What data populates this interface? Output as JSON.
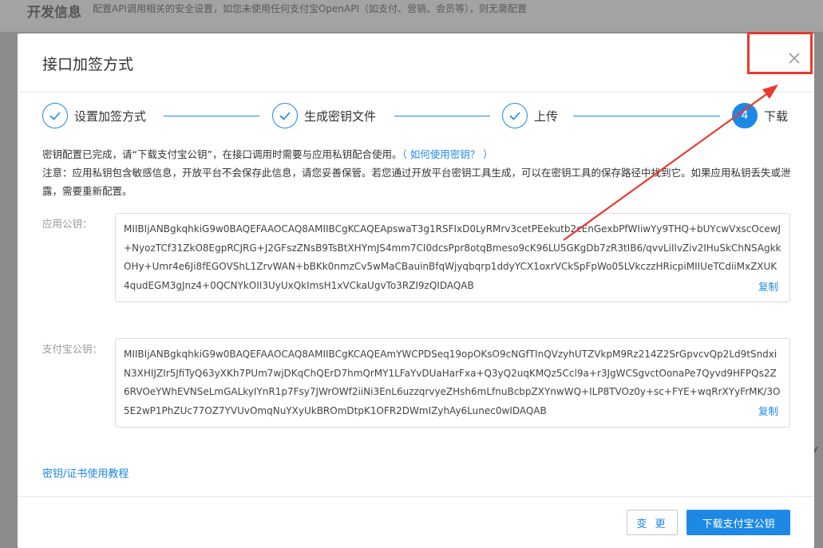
{
  "background": {
    "title": "开发信息",
    "desc": "配置API调用相关的安全设置，如您未使用任何支付宝OpenAPI（如支付、营销、会员等），则无需配置",
    "right_text": "y"
  },
  "modal": {
    "title": "接口加签方式",
    "close_icon": "close-icon"
  },
  "steps": [
    {
      "label": "设置加签方式",
      "status": "done"
    },
    {
      "label": "生成密钥文件",
      "status": "done"
    },
    {
      "label": "上传",
      "status": "done"
    },
    {
      "label": "下载",
      "status": "active",
      "number": "4"
    }
  ],
  "info": {
    "line1": "密钥配置已完成，请“下载支付宝公钥”，在接口调用时需要与应用私钥配合使用。",
    "help_link": "（ 如何使用密钥？ ）",
    "line2": "注意：应用私钥包含敏感信息，开放平台不会保存此信息，请您妥善保管。若您通过开放平台密钥工具生成，可以在密钥工具的保存路径中找到它。如果应用私钥丢失或泄露，需要重新配置。"
  },
  "app_public_key": {
    "label": "应用公钥：",
    "value": "MIIBIjANBgkqhkiG9w0BAQEFAAOCAQ8AMIIBCgKCAQEApswaT3g1RSFIxD0LyRMrv3cetPEekutb2cEnGexbPfWIiwYy9THQ+bUYcwVxscOcewJ+NyozTCf31ZkO8EgpRCJRG+J2GFszZNsB9TsBtXHYmJS4mm7CI0dcsPpr8otqBmeso9cK96LU5GKgDb7zR3tIB6/qvvLiIlvZiv2IHuSkChNSAgkkOHy+Umr4e6Ji8fEGOVShL1ZrvWAN+bBKk0nmzCv5wMaCBauinBfqWjyqbqrp1ddyYCX1oxrVCkSpFpWo05LVkczzHRicpiMIIUeTCdiiMxZXUK4qudEGM3gJnz4+0QCNYkOII3UyUxQkImsH1xVCkaUgvTo3RZI9zQIDAQAB",
    "copy_label": "复制"
  },
  "alipay_public_key": {
    "label": "支付宝公钥：",
    "value": "MIIBIjANBgkqhkiG9w0BAQEFAAOCAQ8AMIIBCgKCAQEAmYWCPDSeq19opOKsO9cNGfTInQVzyhUTZVkpM9Rz214Z2SrGpvcvQp2Ld9tSndxiN3XHIJZIr5JfiTyQ63yXKh7PUm7wjDKqChQErD7hmQrMY1LFaYvDUaHarFxa+Q3yQ2uqKMQz5Ccl9a+r3JgWCSgvctOonaPe7Qyvd9HFPQs2Z6RVOeYWhEVNSeLmGALkyIYnR1p7Fsy7JWrOWf2iiNi3EnL6uzzqrvyeZHsh6mLfnuBcbpZXYnwWQ+ILP8TVOz0y+sc+FYE+wqRrXYyFrMK/3O5E2wP1PhZUc77OZ7YVUvOmqNuYXyUkBROmDtpK1OFR2DWmIZyhAy6Lunec0wIDAQAB",
    "copy_label": "复制"
  },
  "tutorial_link": "密钥/证书使用教程",
  "footer": {
    "change_label": "变 更",
    "download_label": "下载支付宝公钥"
  },
  "colors": {
    "primary": "#1e88e5",
    "annotation": "#e83a2e"
  }
}
